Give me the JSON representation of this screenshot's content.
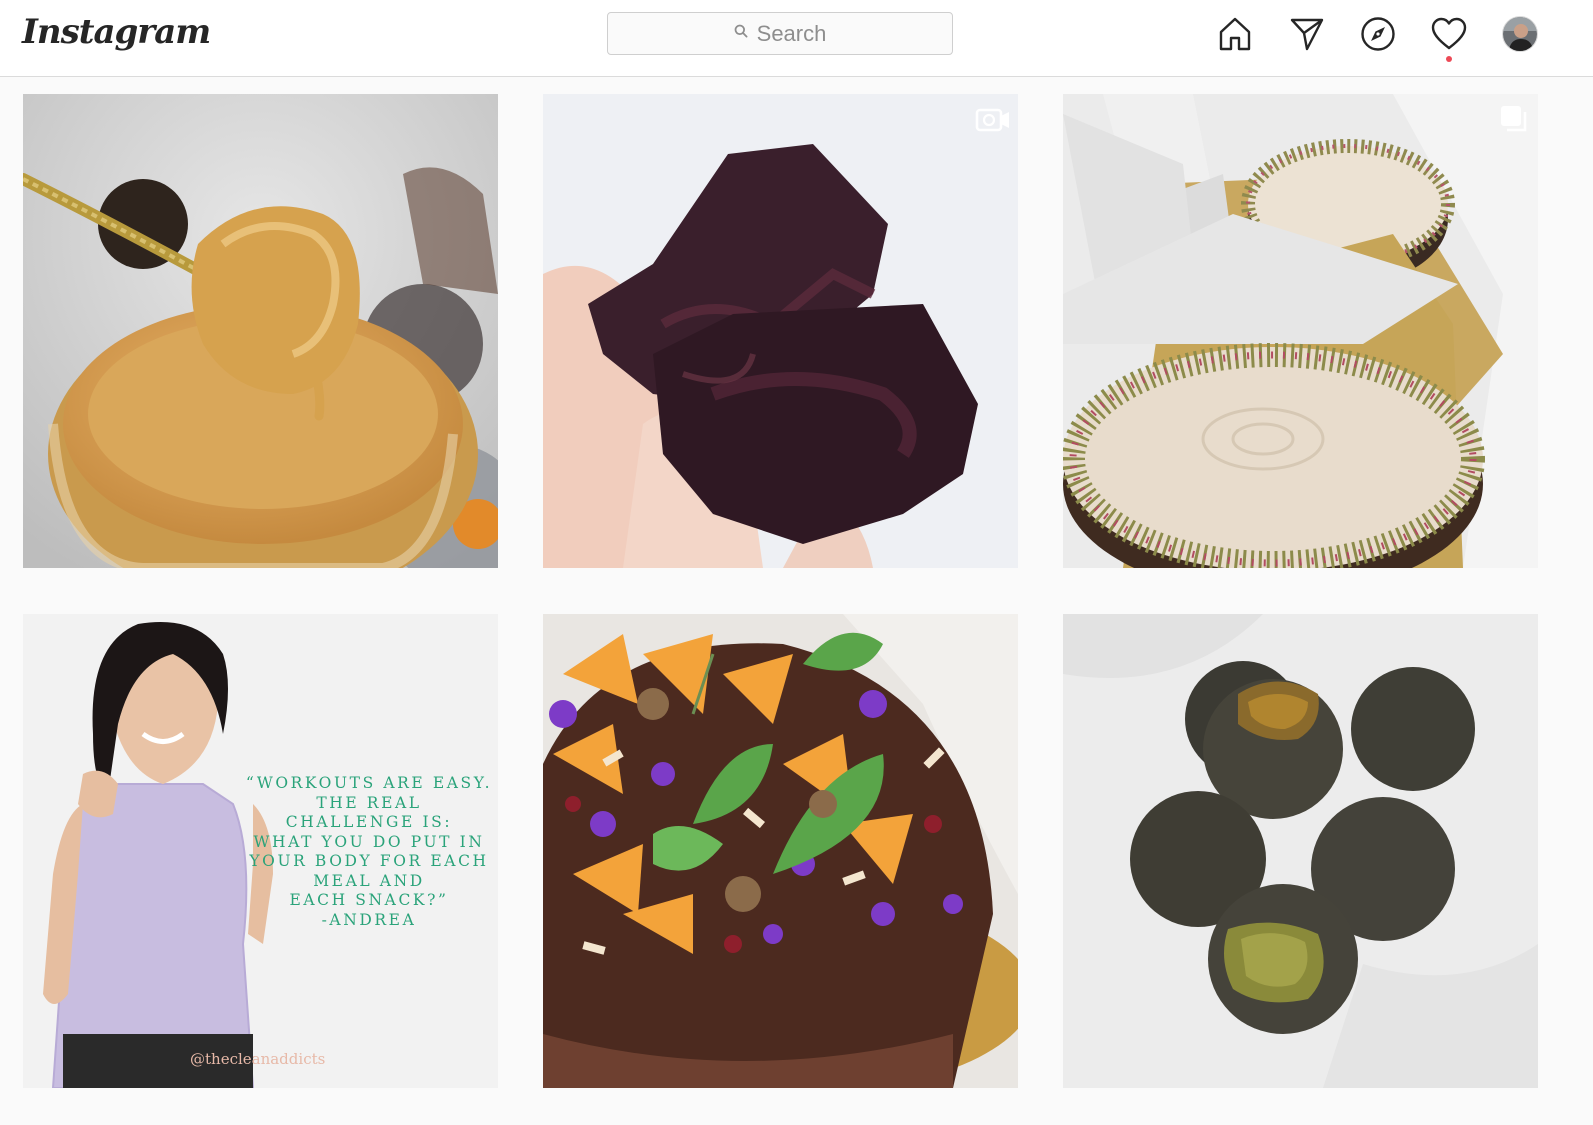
{
  "app": {
    "logo_text": "Instagram",
    "brand_color": "#262626",
    "accent_notification": "#ed4956"
  },
  "search": {
    "placeholder": "Search",
    "icon": "search-icon"
  },
  "nav": {
    "items": [
      {
        "name": "home",
        "icon": "home-icon"
      },
      {
        "name": "direct",
        "icon": "paper-plane-icon"
      },
      {
        "name": "explore",
        "icon": "compass-icon"
      },
      {
        "name": "activity",
        "icon": "heart-icon",
        "has_notification": true
      },
      {
        "name": "profile",
        "icon": "avatar"
      }
    ]
  },
  "posts": [
    {
      "subject": "spoon of nut butter over jar",
      "badge": null
    },
    {
      "subject": "chocolate brownies held in hand",
      "badge": "video-icon"
    },
    {
      "subject": "cakes in boxes",
      "badge": "carousel-icon"
    },
    {
      "subject": "woman in lilac top with quote",
      "badge": null,
      "quote_lines": [
        "“Workouts are easy.",
        "The real",
        "challenge is:",
        "what you do put in",
        "your body for each",
        "meal and",
        "each snack?”",
        "-Andrea"
      ],
      "watermark": "@thecleanaddicts"
    },
    {
      "subject": "chocolate tart with oranges and flowers",
      "badge": null
    },
    {
      "subject": "green-filled energy balls",
      "badge": null
    }
  ]
}
